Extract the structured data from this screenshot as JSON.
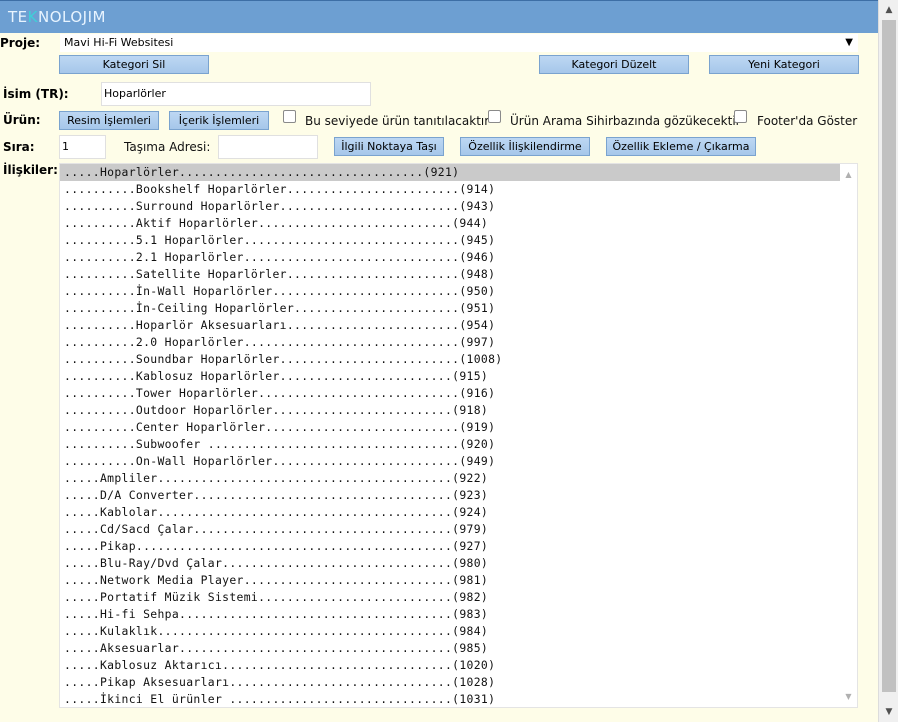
{
  "header": {
    "logo_prefix": "TE",
    "logo_accent": "K",
    "logo_rest": "NOLOJIM"
  },
  "proje": {
    "label": "Proje:",
    "selected": "Mavi Hi-Fi Websitesi"
  },
  "buttons": {
    "kategori_sil": "Kategori Sil",
    "kategori_duzelt": "Kategori Düzelt",
    "yeni_kategori": "Yeni Kategori",
    "resim_islemleri": "Resim İşlemleri",
    "icerik_islemleri": "İçerik İşlemleri",
    "ilgili_noktaya_tasi": "İlgili Noktaya Taşı",
    "ozellik_iliskilendirme": "Özellik İlişkilendirme",
    "ozellik_ekleme_cikarma": "Özellik Ekleme / Çıkarma"
  },
  "isim": {
    "label": "İsim (TR):",
    "value": "Hoparlörler"
  },
  "urun": {
    "label": "Ürün:",
    "checkboxes": [
      {
        "label": "Bu seviyede ürün tanıtılacaktır",
        "checked": false
      },
      {
        "label": "Ürün Arama Sihirbazında gözükecektir",
        "checked": false
      },
      {
        "label": "Footer'da Göster",
        "checked": false
      }
    ]
  },
  "sira": {
    "label": "Sıra:",
    "value": "1"
  },
  "tasima": {
    "label": "Taşıma Adresi:",
    "value": ""
  },
  "iliskiler": {
    "label": "İlişkiler:",
    "selected_index": 0,
    "items": [
      ".....Hoparlörler..................................(921)",
      "..........Bookshelf Hoparlörler........................(914)",
      "..........Surround Hoparlörler.........................(943)",
      "..........Aktif Hoparlörler...........................(944)",
      "..........5.1 Hoparlörler..............................(945)",
      "..........2.1 Hoparlörler..............................(946)",
      "..........Satellite Hoparlörler........................(948)",
      "..........İn-Wall Hoparlörler..........................(950)",
      "..........İn-Ceiling Hoparlörler.......................(951)",
      "..........Hoparlör Aksesuarları........................(954)",
      "..........2.0 Hoparlörler..............................(997)",
      "..........Soundbar Hoparlörler.........................(1008)",
      "..........Kablosuz Hoparlörler........................(915)",
      "..........Tower Hoparlörler............................(916)",
      "..........Outdoor Hoparlörler.........................(918)",
      "..........Center Hoparlörler...........................(919)",
      "..........Subwoofer ...................................(920)",
      "..........On-Wall Hoparlörler..........................(949)",
      ".....Ampliler.........................................(922)",
      ".....D/A Converter....................................(923)",
      ".....Kablolar.........................................(924)",
      ".....Cd/Sacd Çalar....................................(979)",
      ".....Pikap............................................(927)",
      ".....Blu-Ray/Dvd Çalar................................(980)",
      ".....Network Media Player.............................(981)",
      ".....Portatif Müzik Sistemi...........................(982)",
      ".....Hi-fi Sehpa......................................(983)",
      ".....Kulaklık.........................................(984)",
      ".....Aksesuarlar......................................(985)",
      ".....Kablosuz Aktarıcı................................(1020)",
      ".....Pikap Aksesuarları...............................(1028)",
      ".....İkinci El ürünler ...............................(1031)"
    ]
  }
}
